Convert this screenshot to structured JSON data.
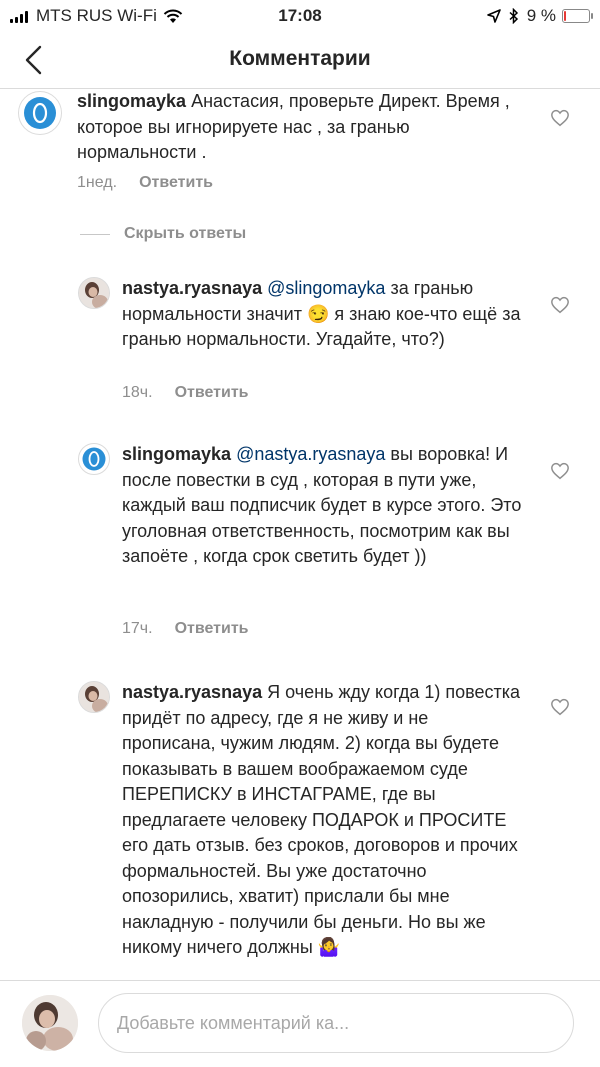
{
  "status_bar": {
    "carrier": "MTS RUS Wi-Fi",
    "time": "17:08",
    "battery_text": "9 %",
    "battery_level": 0.09,
    "battery_color": "#e53935"
  },
  "nav": {
    "title": "Комментарии",
    "back_icon": "chevron-left-icon"
  },
  "colors": {
    "mention": "#003569",
    "meta": "#8e8e8e",
    "avatar_ring": "#2a8fd6"
  },
  "comments": [
    {
      "username": "slingomayka",
      "mention": "",
      "text": "Анастасия, проверьте Директ. Время , которое вы игнорируете нас , за гранью нормальности .",
      "time": "1нед.",
      "reply": "Ответить",
      "avatar": "ring-logo"
    },
    {
      "username": "nastya.ryasnaya",
      "mention": "@slingomayka",
      "text": "за гранью нормальности значит 😏 я знаю кое-что ещё за гранью нормальности. Угадайте, что?)",
      "time": "18ч.",
      "reply": "Ответить",
      "avatar": "photo"
    },
    {
      "username": "slingomayka",
      "mention": "@nastya.ryasnaya",
      "text": "вы воровка! И после повестки в суд , которая в пути уже, каждый ваш подписчик будет в курсе этого. Это уголовная ответственность, посмотрим как вы запоёте , когда срок светить будет ))",
      "time": "17ч.",
      "reply": "Ответить",
      "avatar": "ring-logo"
    },
    {
      "username": "nastya.ryasnaya",
      "mention": "",
      "text": "Я очень жду когда 1) повестка придёт по адресу, где я не живу и не прописана, чужим людям. 2) когда вы будете показывать в вашем воображаемом суде ПЕРЕПИСКУ в ИНСТАГРАМЕ, где вы предлагаете человеку ПОДАРОК и ПРОСИТЕ его дать отзыв. без сроков, договоров и прочих формальностей. Вы уже достаточно опозорились, хватит) прислали бы мне накладную - получили бы деньги. Но вы же никому ничего должны 🤷‍♀️",
      "time": "",
      "reply": "",
      "avatar": "photo"
    }
  ],
  "hide_replies": "Скрыть ответы",
  "input": {
    "placeholder": "Добавьте комментарий ка..."
  }
}
